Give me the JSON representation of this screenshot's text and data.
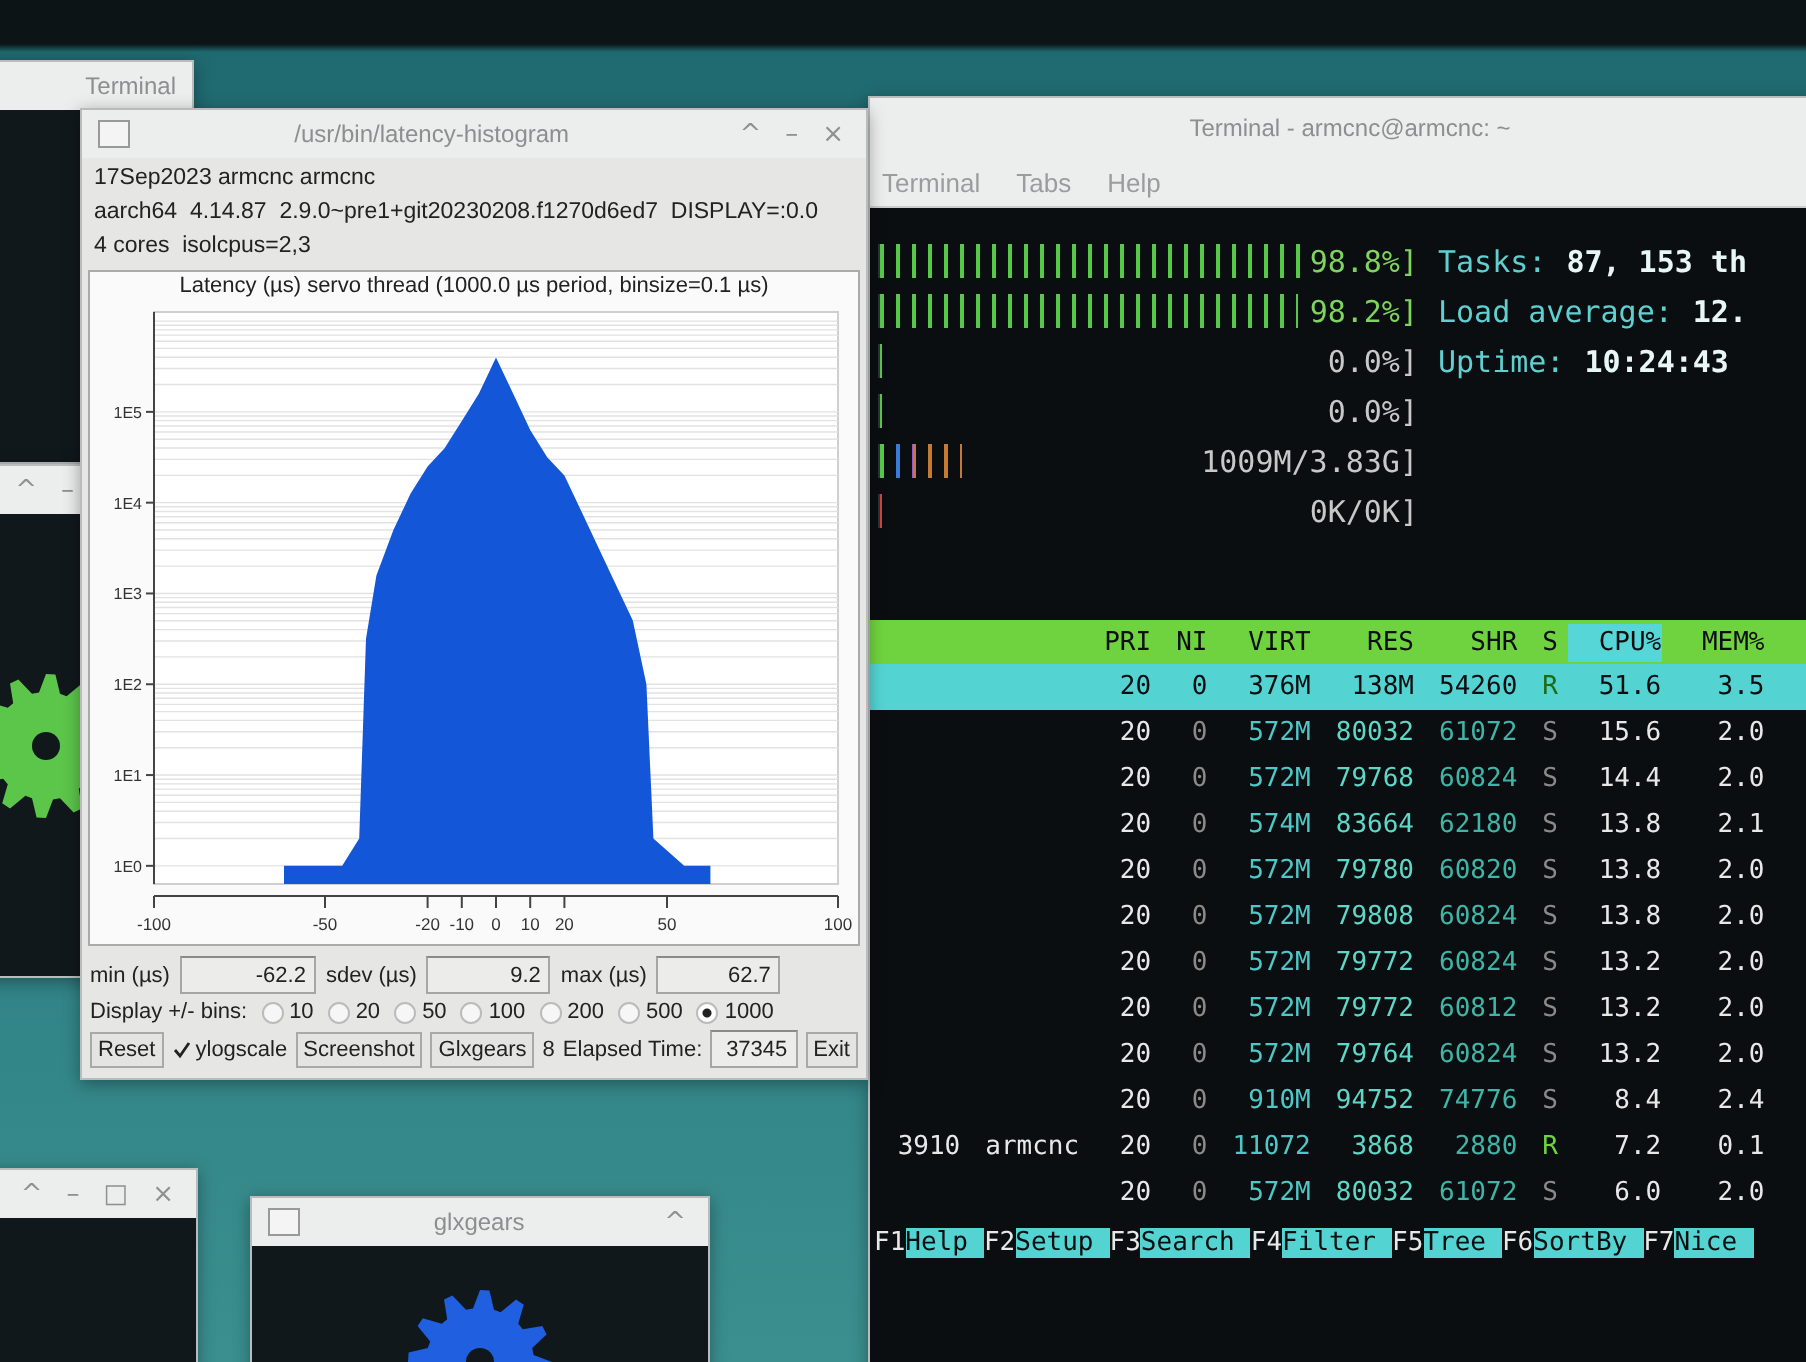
{
  "desktop_windows": [
    {
      "kind": "terminal",
      "title": "Terminal"
    },
    {
      "kind": "gears",
      "controls": [
        "^",
        "–"
      ]
    },
    {
      "kind": "blank",
      "controls": [
        "^",
        "–",
        "□",
        "×"
      ]
    },
    {
      "kind": "glxgears",
      "title": "glxgears",
      "controls": [
        "^"
      ]
    }
  ],
  "terminal_window": {
    "title": "Terminal - armcnc@armcnc: ~",
    "menu": [
      "Terminal",
      "Tabs",
      "Help"
    ],
    "meters": [
      {
        "kind": "cpu",
        "level": 0.988,
        "value": "98.8%]"
      },
      {
        "kind": "cpu",
        "level": 0.982,
        "value": "98.2%]"
      },
      {
        "kind": "cpu",
        "level": 0,
        "value": "0.0%]"
      },
      {
        "kind": "cpu",
        "level": 0,
        "value": "0.0%]"
      },
      {
        "kind": "memory",
        "level": 0.26,
        "value": "1009M/3.83G]"
      },
      {
        "kind": "swap",
        "level": 0,
        "value": "0K/0K]"
      }
    ],
    "summary": [
      {
        "label": "Tasks:",
        "value": "87, 153 th"
      },
      {
        "label": "Load average:",
        "value": "12."
      },
      {
        "label": "Uptime:",
        "value": "10:24:43"
      }
    ],
    "columns": [
      {
        "label": "PRI",
        "sorted": false
      },
      {
        "label": "NI",
        "sorted": false
      },
      {
        "label": "VIRT",
        "sorted": false
      },
      {
        "label": "RES",
        "sorted": false
      },
      {
        "label": "SHR",
        "sorted": false
      },
      {
        "label": "S",
        "sorted": false
      },
      {
        "label": "CPU%",
        "sorted": true
      },
      {
        "label": "MEM%",
        "sorted": false
      }
    ],
    "rows": [
      {
        "selected": true,
        "running": true,
        "cells": [
          "20",
          "0",
          "376M",
          "138M",
          "54260",
          "R",
          "51.6",
          "3.5"
        ]
      },
      {
        "selected": false,
        "running": false,
        "cells": [
          "20",
          "0",
          "572M",
          "80032",
          "61072",
          "S",
          "15.6",
          "2.0"
        ]
      },
      {
        "selected": false,
        "running": false,
        "cells": [
          "20",
          "0",
          "572M",
          "79768",
          "60824",
          "S",
          "14.4",
          "2.0"
        ]
      },
      {
        "selected": false,
        "running": false,
        "cells": [
          "20",
          "0",
          "574M",
          "83664",
          "62180",
          "S",
          "13.8",
          "2.1"
        ]
      },
      {
        "selected": false,
        "running": false,
        "cells": [
          "20",
          "0",
          "572M",
          "79780",
          "60820",
          "S",
          "13.8",
          "2.0"
        ]
      },
      {
        "selected": false,
        "running": false,
        "cells": [
          "20",
          "0",
          "572M",
          "79808",
          "60824",
          "S",
          "13.8",
          "2.0"
        ]
      },
      {
        "selected": false,
        "running": false,
        "cells": [
          "20",
          "0",
          "572M",
          "79772",
          "60824",
          "S",
          "13.2",
          "2.0"
        ]
      },
      {
        "selected": false,
        "running": false,
        "cells": [
          "20",
          "0",
          "572M",
          "79772",
          "60812",
          "S",
          "13.2",
          "2.0"
        ]
      },
      {
        "selected": false,
        "running": false,
        "cells": [
          "20",
          "0",
          "572M",
          "79764",
          "60824",
          "S",
          "13.2",
          "2.0"
        ]
      },
      {
        "selected": false,
        "running": false,
        "cells": [
          "20",
          "0",
          "910M",
          "94752",
          "74776",
          "S",
          "8.4",
          "2.4"
        ]
      },
      {
        "selected": false,
        "running": true,
        "pid": "3910",
        "user": "armcnc",
        "cells": [
          "20",
          "0",
          "11072",
          "3868",
          "2880",
          "R",
          "7.2",
          "0.1"
        ]
      },
      {
        "selected": false,
        "running": false,
        "cells": [
          "20",
          "0",
          "572M",
          "80032",
          "61072",
          "S",
          "6.0",
          "2.0"
        ]
      }
    ],
    "function_keys": [
      {
        "key": "F1",
        "label": "Help"
      },
      {
        "key": "F2",
        "label": "Setup"
      },
      {
        "key": "F3",
        "label": "Search"
      },
      {
        "key": "F4",
        "label": "Filter"
      },
      {
        "key": "F5",
        "label": "Tree"
      },
      {
        "key": "F6",
        "label": "SortBy"
      },
      {
        "key": "F7",
        "label": "Nice"
      }
    ]
  },
  "histogram_window": {
    "title": "/usr/bin/latency-histogram",
    "controls": [
      "^",
      "–",
      "×"
    ],
    "info_lines": [
      "17Sep2023 armcnc armcnc",
      "aarch64  4.14.87  2.9.0~pre1+git20230208.f1270d6ed7  DISPLAY=:0.0",
      "4 cores  isolcpus=2,3"
    ],
    "histogram": {
      "title": "Latency (µs) servo thread (1000.0 µs period, binsize=0.1 µs)",
      "x_tick_labels": [
        "-100",
        "-50",
        "-20",
        "-10",
        "0",
        "10",
        "20",
        "50",
        "100"
      ],
      "y_tick_labels": [
        "1E5",
        "1E4",
        "1E3",
        "1E2",
        "1E1",
        "1E0"
      ]
    },
    "stats": [
      {
        "label": "min (µs)",
        "value": "-62.2"
      },
      {
        "label": "sdev (µs)",
        "value": "9.2"
      },
      {
        "label": "max (µs)",
        "value": "62.7"
      }
    ],
    "bins_label": "Display +/- bins:",
    "bins": [
      {
        "label": "10",
        "selected": false
      },
      {
        "label": "20",
        "selected": false
      },
      {
        "label": "50",
        "selected": false
      },
      {
        "label": "100",
        "selected": false
      },
      {
        "label": "200",
        "selected": false
      },
      {
        "label": "500",
        "selected": false
      },
      {
        "label": "1000",
        "selected": true
      }
    ],
    "reset": "Reset",
    "ylogscale": {
      "label": "ylogscale",
      "checked": true
    },
    "screenshot": "Screenshot",
    "glxgears": "Glxgears",
    "glxgears_count": "8",
    "elapsed_label": "Elapsed Time:",
    "elapsed": "37345",
    "exit": "Exit"
  }
}
